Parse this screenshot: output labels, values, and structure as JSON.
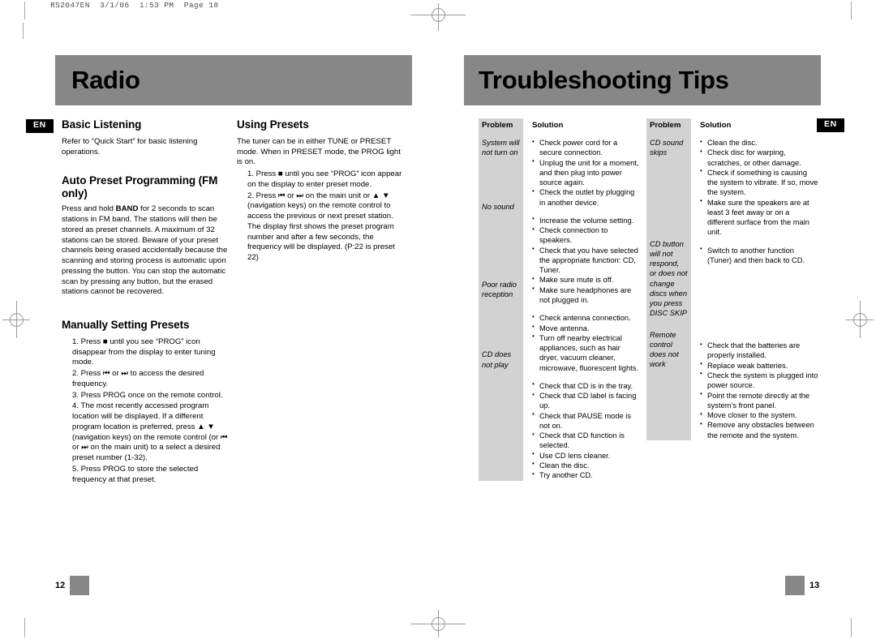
{
  "printer_header": "RS2047EN  3/1/06  1:53 PM  Page 18",
  "language_badge": "EN",
  "left_page": {
    "banner_title": "Radio",
    "page_number": "12",
    "column_a": {
      "sections": [
        {
          "heading": "Basic Listening",
          "paragraph": "Refer to “Quick Start” for basic listening operations."
        },
        {
          "heading": "Auto Preset Programming (FM only)",
          "paragraph_parts": [
            "Press and hold ",
            "BAND",
            " for 2 seconds to scan stations in FM band. The stations will then be stored as preset channels. A maximum of 32 stations can be stored. Beware of your preset channels being erased accidentally because the scanning and storing process is automatic upon pressing the button. You can stop the automatic scan by pressing any button, but the erased stations cannot be recovered."
          ]
        },
        {
          "heading": "Manually Setting Presets",
          "steps": [
            "1. Press ■ until you see “PROG” icon disappear from the display to enter tuning mode.",
            "2. Press ⏮ or ⏭ to access the desired frequency.",
            "3. Press PROG once on the remote control.",
            "4. The most recently accessed program location will be displayed. If a different program location is preferred, press ▲ ▼ (navigation keys) on the remote control (or ⏮ or ⏭ on the main unit) to a select a desired preset number (1-32).",
            "5. Press PROG to store the selected frequency at that preset."
          ]
        }
      ]
    },
    "column_b": {
      "heading": "Using Presets",
      "paragraph": "The tuner can be in either TUNE or PRESET mode. When in PRESET mode, the PROG light is on.",
      "steps": [
        "1. Press ■ until you see “PROG” icon appear on the display to enter preset mode.",
        "2. Press ⏮ or ⏭ on the main unit or ▲ ▼ (navigation keys) on the remote control to access the previous or next preset station. The display first shows the preset program number and after a few seconds, the frequency will be displayed.  (P:22 is preset 22)"
      ]
    }
  },
  "right_page": {
    "banner_title": "Troubleshooting Tips",
    "page_number": "13",
    "table_headers": {
      "problem": "Problem",
      "solution": "Solution"
    },
    "table_1": [
      {
        "problem": "System will not turn on",
        "solutions": [
          "Check power cord for a secure connection.",
          "Unplug the unit for a moment, and then plug into power source again.",
          "Check the outlet by plugging in another device."
        ]
      },
      {
        "problem": "No sound",
        "solutions": [
          "Increase the volume setting.",
          "Check connection to speakers.",
          "Check that you have selected the appropriate function: CD, Tuner.",
          "Make sure mute is off.",
          "Make sure headphones are not plugged in."
        ]
      },
      {
        "problem": "Poor radio reception",
        "solutions": [
          "Check antenna connection.",
          "Move antenna.",
          "Turn off nearby electrical appliances, such as hair dryer, vacuum cleaner, microwave, fluorescent lights."
        ]
      },
      {
        "problem": "CD does not play",
        "solutions": [
          "Check that CD is in the tray.",
          "Check that CD label is facing up.",
          "Check that PAUSE mode is not on.",
          "Check that CD function is selected.",
          "Use CD lens cleaner.",
          "Clean the disc.",
          "Try another CD."
        ]
      }
    ],
    "table_2": [
      {
        "problem": "CD sound skips",
        "solutions": [
          "Clean the disc.",
          "Check disc for warping, scratches, or other damage.",
          "Check if something is causing the system to  vibrate. If so, move the  system.",
          "Make sure the speakers are at least 3 feet away or on a different surface from the main unit."
        ]
      },
      {
        "problem": "CD button will not respond, or does not change discs when you press DISC SKIP",
        "solutions": [
          "Switch to another function (Tuner) and then back to CD."
        ]
      },
      {
        "problem": "Remote control does not work",
        "solutions": [
          "Check that the batteries are properly installed.",
          "Replace weak batteries.",
          "Check the system is plugged into power source.",
          "Point the remote directly at the system’s front panel.",
          "Move closer to the system.",
          "Remove any obstacles between the remote and the system."
        ]
      }
    ]
  },
  "colors": {
    "banner_gray": "#878787",
    "table_header_gray": "#d2d2d2",
    "badge_black": "#000000",
    "page_square_gray": "#878787",
    "crop_mark_gray": "#9a9a9a"
  }
}
